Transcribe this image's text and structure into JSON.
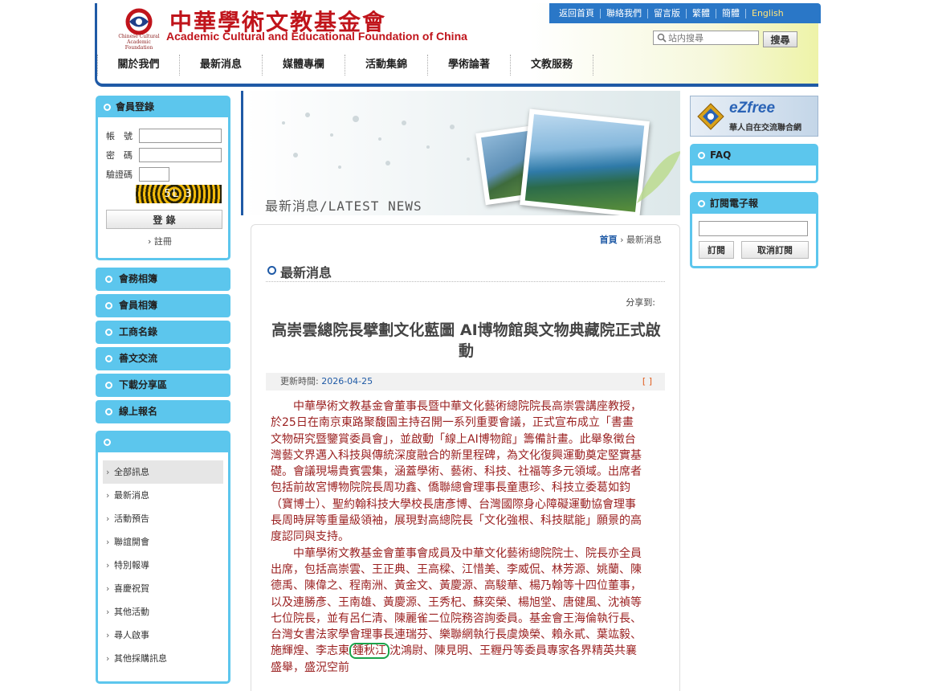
{
  "header": {
    "logo_cn": "中華學術文教基金會",
    "logo_en": "Academic Cultural and Educational Foundation of China",
    "logo_mark_text": "Chinese Cultural Academic Foundation",
    "toplinks": [
      "返回首頁",
      "聯絡我們",
      "留言版",
      "繁體",
      "簡體",
      "English"
    ],
    "search_placeholder": "站内搜尋",
    "search_button": "搜尋",
    "nav": [
      "關於我們",
      "最新消息",
      "媒體專欄",
      "活動集錦",
      "學術論著",
      "文教服務"
    ]
  },
  "login": {
    "title": "會員登錄",
    "account_label": "帳　號",
    "password_label": "密　碼",
    "captcha_label": "驗證碼",
    "captcha_text": "5L 3",
    "login_button": "登 錄",
    "register_link": "註冊"
  },
  "left_menu": [
    "會務相簿",
    "會員相簿",
    "工商名錄",
    "善文交流",
    "下載分享區",
    "線上報名"
  ],
  "categories": [
    "全部訊息",
    "最新消息",
    "活動預告",
    "聯誼開會",
    "特別報導",
    "喜慶祝賀",
    "其他活動",
    "尋人啟事",
    "其他採購訊息"
  ],
  "banner": {
    "title": "最新消息/LATEST NEWS"
  },
  "content": {
    "breadcrumb_home": "首頁",
    "breadcrumb_sep": "›",
    "breadcrumb_current": "最新消息",
    "section_title": "最新消息",
    "share_label": "分享到:",
    "article_title": "高崇雲總院長擘劃文化藍圖 AI博物館與文物典藏院正式啟動",
    "meta_label": "更新時間:",
    "meta_date": "2026-04-25",
    "meta_brackets": "[ ]",
    "para1": "中華學術文教基金會董事長暨中華文化藝術總院院長高崇雲講座教授，於25日在南京東路聚馥園主持召開一系列重要會議，正式宣布成立「書畫文物研究暨鑒賞委員會」，並啟動「線上AI博物館」籌備計畫。此舉象徵台灣藝文界邁入科技與傳統深度融合的新里程碑，為文化復興運動奠定堅實基礎。會議現場貴賓雲集，涵蓋學術、藝術、科技、社福等多元領域。出席者包括前故宮博物院院長周功鑫、僑聯總會理事長童惠珍、科技立委葛如鈞（寶博士）、聖約翰科技大學校長唐彥博、台灣國際身心障礙運動協會理事長周時屏等重量級領袖，展現對高總院長「文化強根、科技賦能」願景的高度認同與支持。",
    "para2_before": "中華學術文教基金會董事會成員及中華文化藝術總院院士、院長亦全員出席，包括高崇雲、王正典、王高樑、江惜美、李威侃、林芳源、姚蘭、陳德禹、陳偉之、程南洲、黃金文、黃慶源、高駿華、楊乃翰等十四位董事，以及連勝彥、王南雄、黃慶源、王秀杞、蘇奕榮、楊旭堂、唐健風、沈禎等七位院長，並有呂仁清、陳麗雀二位院務咨詢委員。基金會王海倫執行長、台灣女書法家學會理事長連瑞芬、樂聯網執行長虞煥榮、賴永貳、葉竑毅、施輝煌、李志東",
    "para2_highlight": "鍾秋江",
    "para2_after": "沈鴻尉、陳見明、王糎丹等委員專家各界精英共襄盛舉，盛況空前"
  },
  "right": {
    "ezfree_title": "eZfree",
    "ezfree_sub": "華人自在交流聯合網",
    "faq_title": "FAQ",
    "subscribe_title": "訂閱電子報",
    "subscribe_button": "訂閱",
    "unsubscribe_button": "取消訂閱"
  },
  "colors": {
    "accent_blue": "#1f5aa6",
    "panel_cyan": "#5cc6ed",
    "brand_red": "#c0141b",
    "body_text": "#9a1f1f",
    "highlight_green": "#1aa34a"
  }
}
